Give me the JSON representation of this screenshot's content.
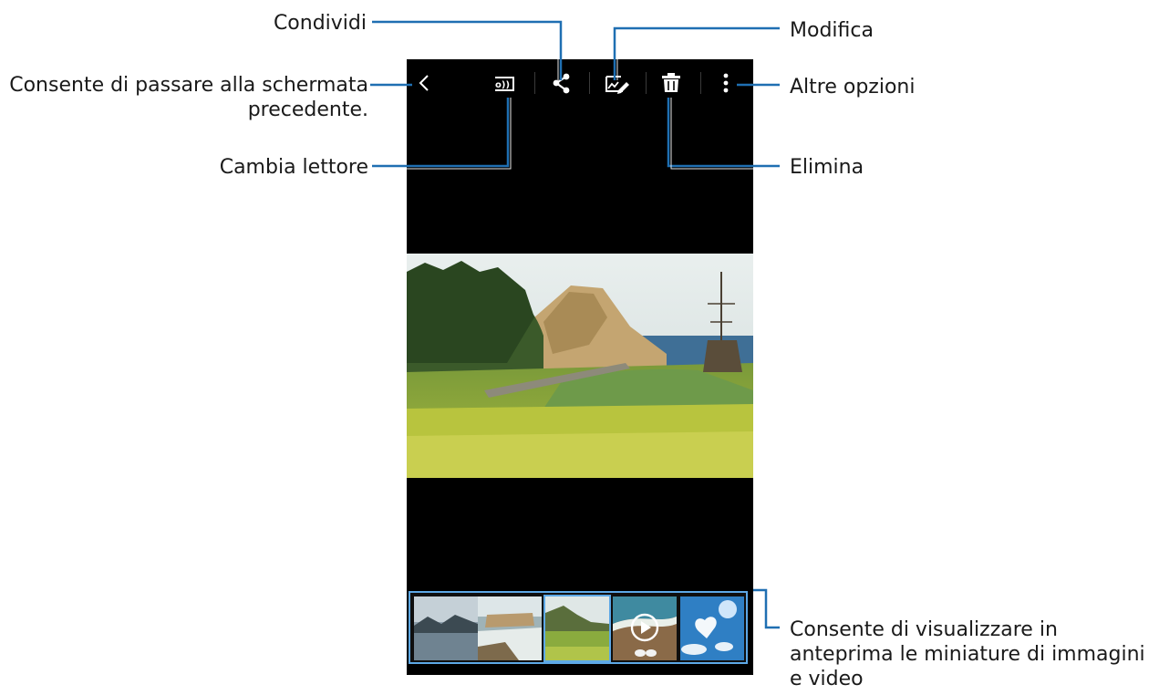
{
  "callouts": {
    "share": "Condividi",
    "edit": "Modifica",
    "back_line1": "Consente di passare alla schermata",
    "back_line2": "precedente.",
    "more_options": "Altre opzioni",
    "change_player": "Cambia lettore",
    "delete": "Elimina",
    "thumbnails_line1": "Consente di visualizzare in",
    "thumbnails_line2": "anteprima le miniature di immagini",
    "thumbnails_line3": "e video"
  },
  "toolbar": {
    "icons": [
      "back-icon",
      "change-player-icon",
      "share-icon",
      "edit-icon",
      "delete-icon",
      "more-options-icon"
    ]
  },
  "thumbnails": {
    "count": 5,
    "selected_index": 2,
    "video_index": 3
  },
  "colors": {
    "leader_line": "#1f6fb2",
    "highlight": "#5da8e6",
    "screen_background": "#000000"
  }
}
